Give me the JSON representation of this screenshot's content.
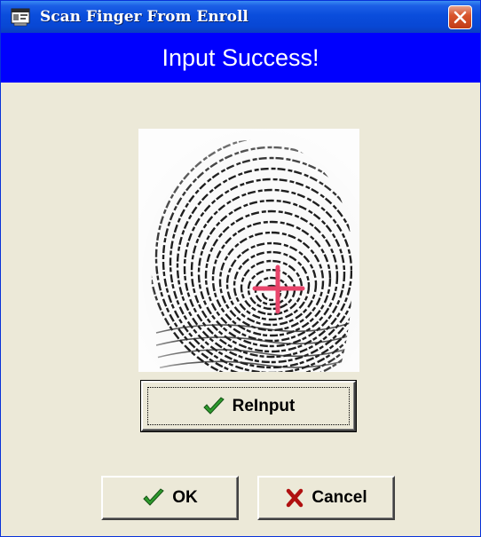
{
  "window": {
    "title": "Scan Finger From Enroll",
    "icon": "scanner-app-icon",
    "close_icon": "close-x-icon"
  },
  "banner": {
    "message": "Input Success!",
    "background_color": "#0000fe"
  },
  "fingerprint": {
    "image": "fingerprint-image",
    "marker_icon": "crosshair-icon",
    "marker_color": "#e8446a"
  },
  "buttons": {
    "reinput_label": "ReInput",
    "ok_label": "OK",
    "cancel_label": "Cancel",
    "check_icon": "checkmark-icon",
    "cancel_icon": "red-x-icon"
  }
}
